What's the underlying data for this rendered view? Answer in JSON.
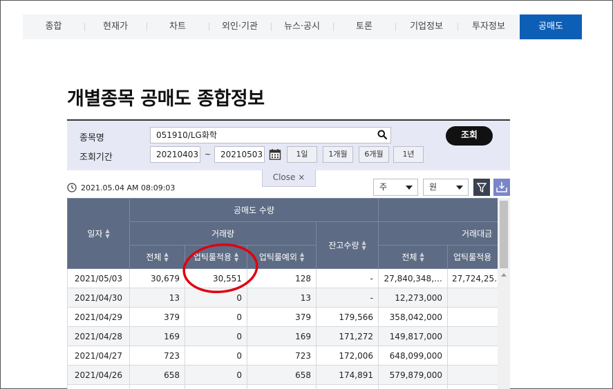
{
  "nav": {
    "items": [
      {
        "label": "종합"
      },
      {
        "label": "현재가"
      },
      {
        "label": "차트"
      },
      {
        "label": "외인·기관"
      },
      {
        "label": "뉴스·공시"
      },
      {
        "label": "토론"
      },
      {
        "label": "기업정보"
      },
      {
        "label": "투자정보"
      },
      {
        "label": "공매도",
        "active": true
      }
    ]
  },
  "page_title": "개별종목 공매도 종합정보",
  "search": {
    "stock_label": "종목명",
    "stock_value": "051910/LG화학",
    "period_label": "조회기간",
    "date_from": "20210403",
    "tilde": "~",
    "date_to": "20210503",
    "submit_label": "조회",
    "period_buttons": [
      "1일",
      "1개월",
      "6개월",
      "1년"
    ]
  },
  "close_tab": "Close ×",
  "timestamp": "2021.05.04 AM 08:09:03",
  "unit_select": {
    "value": "주"
  },
  "currency_select": {
    "value": "원"
  },
  "colors": {
    "header_bg": "#5d6b84",
    "nav_active": "#0d5fb5",
    "panel_bg": "#e6e9f5",
    "annotation": "#e0000f",
    "download": "#7a86c8"
  },
  "table": {
    "headers": {
      "date": "일자",
      "short_qty": "공매도 수량",
      "volume": "거래량",
      "balance_qty": "잔고수량",
      "trade_amount": "거래대금",
      "total": "전체",
      "uptick_applied": "업틱룰적용",
      "uptick_exempt": "업틱룰예외"
    },
    "rows": [
      {
        "date": "2021/05/03",
        "total": "30,679",
        "uptick": "30,551",
        "exempt": "128",
        "balance": "-",
        "amt_total": "27,840,348,…",
        "amt_uptick": "27,724,25…"
      },
      {
        "date": "2021/04/30",
        "total": "13",
        "uptick": "0",
        "exempt": "13",
        "balance": "-",
        "amt_total": "12,273,000",
        "amt_uptick": ""
      },
      {
        "date": "2021/04/29",
        "total": "379",
        "uptick": "0",
        "exempt": "379",
        "balance": "179,566",
        "amt_total": "358,042,000",
        "amt_uptick": ""
      },
      {
        "date": "2021/04/28",
        "total": "169",
        "uptick": "0",
        "exempt": "169",
        "balance": "171,272",
        "amt_total": "149,817,000",
        "amt_uptick": ""
      },
      {
        "date": "2021/04/27",
        "total": "723",
        "uptick": "0",
        "exempt": "723",
        "balance": "172,006",
        "amt_total": "648,099,000",
        "amt_uptick": ""
      },
      {
        "date": "2021/04/26",
        "total": "658",
        "uptick": "0",
        "exempt": "658",
        "balance": "174,891",
        "amt_total": "579,879,000",
        "amt_uptick": ""
      },
      {
        "date": "",
        "total": "",
        "uptick": "",
        "exempt": "",
        "balance": "",
        "amt_total": "",
        "amt_uptick": ""
      }
    ]
  }
}
